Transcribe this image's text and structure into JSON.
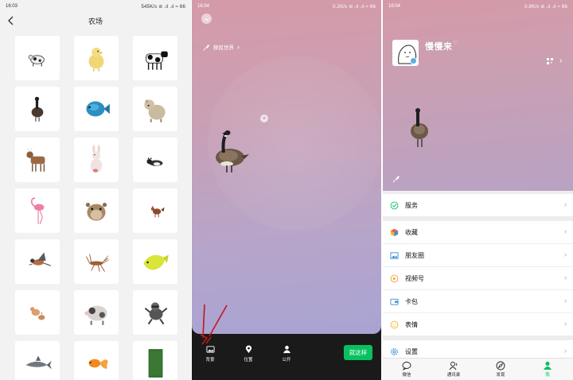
{
  "colors": {
    "accent": "#07c160",
    "link": "#5ab0e4"
  },
  "left": {
    "status": {
      "time": "16:03",
      "right": "545K/s ⊘ .ıl .ıl ≈ 66"
    },
    "title": "农场",
    "icons": [
      "back-icon"
    ],
    "animals": [
      "cow-sticker",
      "chick-sticker",
      "cow-sticker",
      "goose-sticker",
      "fish-sticker",
      "bear-sticker",
      "goat-sticker",
      "rabbit-sticker",
      "cat-sticker",
      "flamingo-sticker",
      "hamster-sticker",
      "rooster-sticker",
      "bird-sticker",
      "insect-sticker",
      "yellow-fish-sticker",
      "kitten-sticker",
      "pig-sticker",
      "raccoon-sticker",
      "shark-sticker",
      "goldfish-sticker",
      "grass-sticker"
    ]
  },
  "middle": {
    "status": {
      "time": "16:04",
      "right": "0.2K/s ⊘ .ıl .ıl ≈ 66"
    },
    "world_link": "移民世界",
    "close": "×",
    "toolbar": {
      "background": "背景",
      "location": "位置",
      "public": "公开",
      "confirm": "就这样"
    }
  },
  "right": {
    "status": {
      "time": "16:04",
      "right": "0.8K/s ⊘ .ıl .ıl ≈ 66"
    },
    "nickname": "慢慢来",
    "nickname_mark": "♡",
    "chevron": "›",
    "menu": {
      "services": "服务",
      "favorites": "收藏",
      "moments": "朋友圈",
      "channels": "视频号",
      "cards": "卡包",
      "stickers": "表情",
      "settings": "设置"
    },
    "tabs": {
      "chats": "微信",
      "contacts": "通讯录",
      "discover": "发现",
      "me": "我"
    }
  }
}
